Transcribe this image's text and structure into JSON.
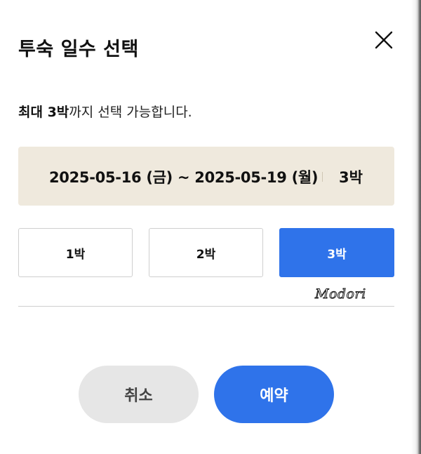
{
  "dialog": {
    "title": "투숙 일수 선택",
    "close_icon": "close-icon"
  },
  "notice": {
    "strong": "최대 3박",
    "rest": "까지 선택 가능합니다."
  },
  "selection": {
    "date_range": "2025-05-16 (금) ~ 2025-05-19 (월)",
    "nights": "3박"
  },
  "night_options": [
    {
      "label": "1박",
      "selected": false
    },
    {
      "label": "2박",
      "selected": false
    },
    {
      "label": "3박",
      "selected": true
    }
  ],
  "watermark": "Modori",
  "buttons": {
    "cancel": "취소",
    "reserve": "예약"
  },
  "colors": {
    "accent": "#2f73ea",
    "date_box_bg": "#efe9dd",
    "cancel_bg": "#e6e6e6"
  }
}
